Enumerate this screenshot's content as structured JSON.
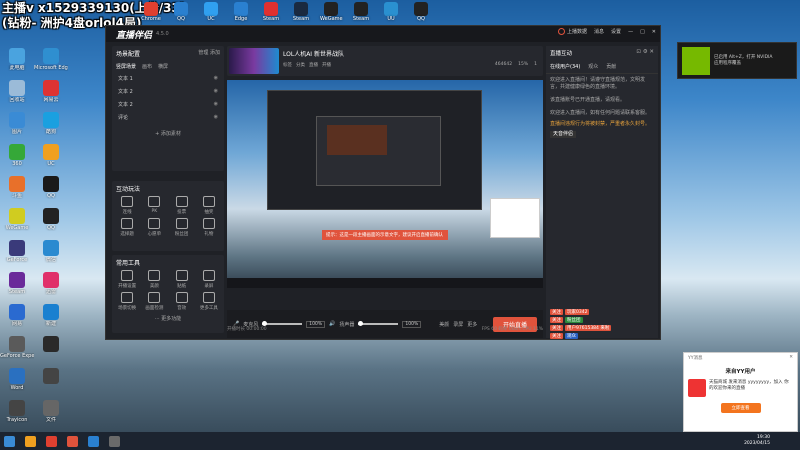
{
  "overlay": {
    "line1": "主播v x1529339130(上分/33)",
    "line2": "(钻粉- 洲护4盘orlol4局)"
  },
  "desktop_left": [
    {
      "label": "此电脑",
      "color": "#4aa3df"
    },
    {
      "label": "Microsoft Edge",
      "color": "#2f8fd0"
    },
    {
      "label": "回收站",
      "color": "#9bbbd8"
    },
    {
      "label": "网易云",
      "color": "#d33"
    },
    {
      "label": "图片",
      "color": "#3a8bd5"
    },
    {
      "label": "酷狗",
      "color": "#1aa0e0"
    },
    {
      "label": "360",
      "color": "#35a838"
    },
    {
      "label": "UC",
      "color": "#f0a020"
    },
    {
      "label": "斗鱼",
      "color": "#e8702a"
    },
    {
      "label": "QQ",
      "color": "#1a1a1a"
    },
    {
      "label": "WeGame",
      "color": "#d0cc20"
    },
    {
      "label": "QQ",
      "color": "#222"
    },
    {
      "label": "GeForce",
      "color": "#3a3a7a"
    },
    {
      "label": "微信",
      "color": "#2a8ad0"
    },
    {
      "label": "Steam",
      "color": "#6a2a9a"
    },
    {
      "label": "迅雷",
      "color": "#e0306a"
    },
    {
      "label": "网易",
      "color": "#2a6ad0"
    },
    {
      "label": "新建",
      "color": "#1a80d0"
    },
    {
      "label": "GeForce Experience",
      "color": "#5a5a5a"
    },
    {
      "label": "",
      "color": "#2a2a2a"
    },
    {
      "label": "Word",
      "color": "#2a70c0"
    },
    {
      "label": "",
      "color": "#444"
    },
    {
      "label": "Trayicon",
      "color": "#444"
    },
    {
      "label": "文件",
      "color": "#666"
    }
  ],
  "desktop_top": [
    {
      "label": "Chrome",
      "color": "#e04030"
    },
    {
      "label": "QQ",
      "color": "#2a80d0"
    },
    {
      "label": "UC",
      "color": "#30a0f0"
    },
    {
      "label": "Edge",
      "color": "#2a80d0"
    },
    {
      "label": "Steam",
      "color": "#e03030"
    },
    {
      "label": "Steam",
      "color": "#1a2a40"
    },
    {
      "label": "WeGame",
      "color": "#222"
    },
    {
      "label": "Steam",
      "color": "#222"
    },
    {
      "label": "UU",
      "color": "#2a90d0"
    },
    {
      "label": "QQ",
      "color": "#222"
    }
  ],
  "window": {
    "logo": "直播伴侣",
    "version": "4.5.0",
    "top_buttons": [
      "上播数据",
      "消息",
      "设置"
    ],
    "scene": {
      "title": "场景配置",
      "actions": [
        "管理",
        "添加"
      ],
      "tabs": [
        "竖屏场景",
        "画布",
        "横屏"
      ]
    },
    "sources": [
      "文本 1",
      "文本 2",
      "文本 2",
      "评论"
    ],
    "add_source": "+ 添加素材",
    "interact": {
      "title": "互动玩法",
      "items": [
        "连线",
        "PK",
        "投票",
        "抽奖",
        "选择题",
        "心愿单",
        "粉丝团",
        "礼物"
      ]
    },
    "tools": {
      "title": "常用工具",
      "items": [
        "开播设置",
        "美颜",
        "贴纸",
        "录屏",
        "场景切换",
        "画面检测",
        "音效",
        "更多工具"
      ],
      "more": "··· 更多功能"
    },
    "stream": {
      "title": "LOL人机AI 新世界战队",
      "tags": [
        "标签",
        "分类",
        "直播",
        "开播"
      ],
      "stats": [
        "464642",
        "15%",
        "1"
      ]
    },
    "toast": "提示：这是一段主播画面的示意文字，建议开启直播前确认",
    "controls": {
      "mic": "麦克风",
      "mic_pct": "100%",
      "speaker": "扬声器",
      "speaker_pct": "100%",
      "btns": [
        "美颜",
        "录屏",
        "更多"
      ],
      "start": "开始直播"
    },
    "status": {
      "left": "开播时长 00:00:00",
      "right": "FPS 60  码率 0kb/s  CPU 11%"
    },
    "right": {
      "title": "直播互动",
      "tabs": [
        "在线用户(34)",
        "观众",
        "贡献"
      ],
      "chat": [
        "欢迎进入直播间！请遵守直播规范，文明发言，共建健康绿色的直播环境。",
        "该直播账号已开通直播，请观看。",
        "欢迎进入直播间，如有任何问题请联系客服。",
        "直播间违规行为将被封禁，严重者永久封号。"
      ],
      "notice": "天音伴侣",
      "msgs": [
        {
          "tag": "关注",
          "user": "玩家0342",
          "color": "#e0533c"
        },
        {
          "tag": "关注",
          "user": "粉丝团",
          "color": "#2a8a3a"
        },
        {
          "tag": "关注",
          "user": "用户97615384 来啦",
          "color": "#e0533c"
        },
        {
          "tag": "关注",
          "user": "观众",
          "color": "#2a60c0"
        }
      ]
    }
  },
  "nvidia": {
    "line1": "已启用 Alt+Z，打开 NVIDIA",
    "line2": "应用程序覆盖"
  },
  "yy": {
    "header": "YY消息",
    "title": "来自YY用户",
    "body": "天猫商城 发来消息 yyyyyyyy，加入 你的欢迎你来的直播",
    "button": "立即查看"
  },
  "clock": {
    "time": "19:30",
    "date": "2023/04/15"
  },
  "colors": {
    "accent": "#e0533c",
    "window_bg": "#1f2126"
  }
}
